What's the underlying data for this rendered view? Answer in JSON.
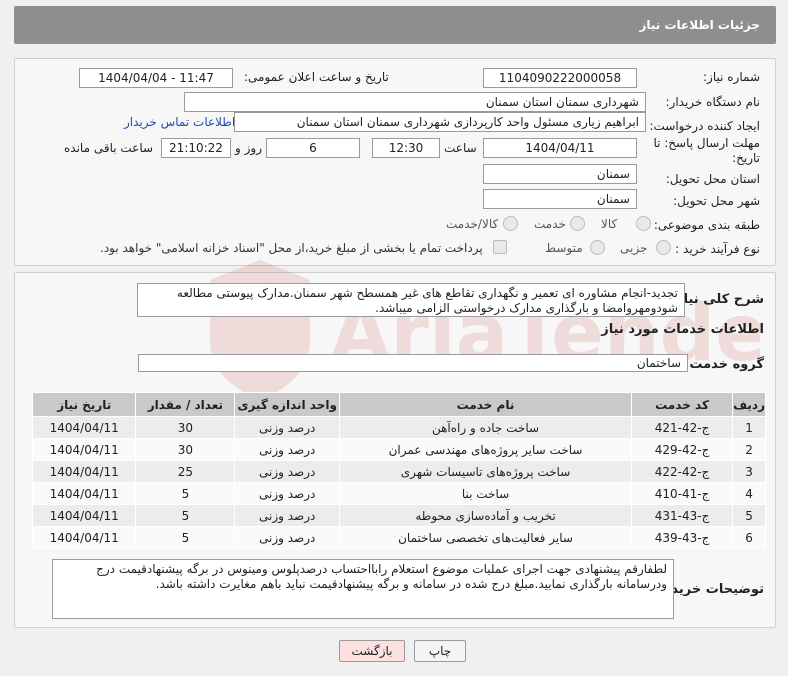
{
  "header": {
    "title": "جزئیات اطلاعات نیاز"
  },
  "form": {
    "need_number_label": "شماره نیاز:",
    "need_number": "1104090222000058",
    "announce_label": "تاریخ و ساعت اعلان عمومی:",
    "announce_value": "1404/04/04 - 11:47",
    "buyer_org_label": "نام دستگاه خریدار:",
    "buyer_org": "شهرداری سمنان استان سمنان",
    "creator_label": "ایجاد کننده درخواست:",
    "creator": "ابراهیم زیاری مسئول واحد کارپردازی شهرداری سمنان استان سمنان",
    "contact_link": "اطلاعات تماس خریدار",
    "deadline_label_1": "مهلت ارسال پاسخ: تا",
    "deadline_label_2": "تاریخ:",
    "deadline_date": "1404/04/11",
    "time_label": "ساعت",
    "deadline_time": "12:30",
    "days_value": "6",
    "days_label": "روز و",
    "remaining_time": "21:10:22",
    "remaining_label": "ساعت باقی مانده",
    "province_label": "استان محل تحویل:",
    "province": "سمنان",
    "city_label": "شهر محل تحویل:",
    "city": "سمنان",
    "category_label": "طبقه بندی موضوعی:",
    "category_options": [
      "کالا",
      "خدمت",
      "کالا/خدمت"
    ],
    "process_label": "نوع فرآیند خرید :",
    "process_options": [
      "جزیی",
      "متوسط"
    ],
    "payment_note": "پرداخت تمام یا بخشی از مبلغ خرید،از محل \"اسناد خزانه اسلامی\" خواهد بود."
  },
  "summary": {
    "label": "شرح کلی نیاز:",
    "text": "تجدید-انجام مشاوره ای تعمیر و نگهداری تقاطع های غیر همسطح شهر سمنان.مدارک پیوستی مطالعه شودومهروامضا و بارگذاری مدارک درخواستی الزامی میباشد."
  },
  "services": {
    "section_title": "اطلاعات خدمات مورد نیاز",
    "group_label": "گروه خدمت:",
    "group_value": "ساختمان",
    "columns": [
      "ردیف",
      "کد خدمت",
      "نام خدمت",
      "واحد اندازه گیری",
      "تعداد / مقدار",
      "تاریخ نیاز"
    ],
    "rows": [
      [
        "1",
        "ج-42-421",
        "ساخت جاده و راه‌آهن",
        "درصد وزنی",
        "30",
        "1404/04/11"
      ],
      [
        "2",
        "ج-42-429",
        "ساخت سایر پروژه‌های مهندسی عمران",
        "درصد وزنی",
        "30",
        "1404/04/11"
      ],
      [
        "3",
        "ج-42-422",
        "ساخت پروژه‌های تاسیسات شهری",
        "درصد وزنی",
        "25",
        "1404/04/11"
      ],
      [
        "4",
        "ج-41-410",
        "ساخت بنا",
        "درصد وزنی",
        "5",
        "1404/04/11"
      ],
      [
        "5",
        "ج-43-431",
        "تخریب و آماده‌سازی محوطه",
        "درصد وزنی",
        "5",
        "1404/04/11"
      ],
      [
        "6",
        "ج-43-439",
        "سایر فعالیت‌های تخصصی ساختمان",
        "درصد وزنی",
        "5",
        "1404/04/11"
      ]
    ]
  },
  "buyer_notes": {
    "label": "توضیحات خریدار:",
    "text": "لطفارقم پیشنهادی جهت اجرای عملیات موضوع استعلام رابااحتساب درصدپلوس ومینوس در برگه پیشنهادقیمت درج ودرسامانه بارگذاری نمایید.مبلغ درج شده در سامانه و برگه پیشنهادقیمت نباید باهم مغایرت داشته باشد."
  },
  "buttons": {
    "print": "چاپ",
    "back": "بازگشت"
  },
  "watermark": {
    "text": "AriaTender.neT"
  },
  "colors": {
    "header_bg": "#8e8e8e",
    "link": "#1e4fb0",
    "watermark": "#c62828",
    "back_button_bg": "#fde0e0"
  }
}
